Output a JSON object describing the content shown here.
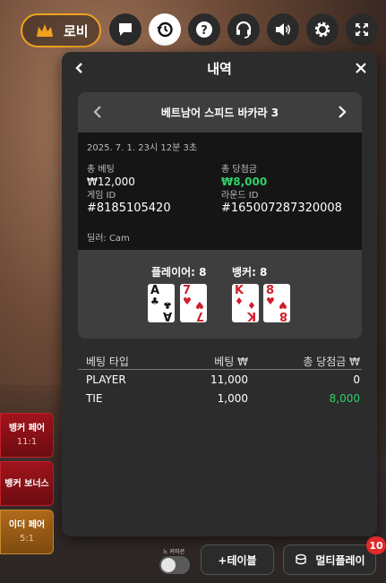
{
  "topbar": {
    "lobby_label": "로비",
    "icons": [
      "chat-icon",
      "history-icon",
      "help-icon",
      "headset-icon",
      "volume-icon",
      "gear-icon",
      "fullscreen-icon"
    ]
  },
  "side_bets": [
    {
      "title": "뱅커 페어",
      "sub": "11:1"
    },
    {
      "title": "뱅커 보너스",
      "sub": ""
    },
    {
      "title": "이더 페어",
      "sub": "5:1"
    }
  ],
  "modal": {
    "title": "내역",
    "game_name": "베트남어 스피드 바카라 3",
    "datetime": "2025. 7. 1. 23시 12분 3초",
    "total_bet_label": "총 베팅",
    "total_bet_value": "₩12,000",
    "total_win_label": "총 당첨금",
    "total_win_value": "₩8,000",
    "game_id_label": "게임 ID",
    "game_id_value": "#8185105420",
    "round_id_label": "라운드 ID",
    "round_id_value": "#165007287320008",
    "dealer": "딜러: Cam",
    "player_label": "플레이어: 8",
    "banker_label": "뱅커: 8",
    "player_cards": [
      {
        "rank": "A",
        "suit": "♣",
        "color": "black"
      },
      {
        "rank": "7",
        "suit": "♥",
        "color": "red"
      }
    ],
    "banker_cards": [
      {
        "rank": "K",
        "suit": "♦",
        "color": "red"
      },
      {
        "rank": "8",
        "suit": "♥",
        "color": "red"
      }
    ],
    "table_headers": [
      "베팅 타입",
      "베팅 ₩",
      "총 당첨금 ₩"
    ],
    "rows": [
      {
        "type": "PLAYER",
        "bet": "11,000",
        "win": "0",
        "win_color": "#ffffff"
      },
      {
        "type": "TIE",
        "bet": "1,000",
        "win": "8,000",
        "win_color": "#2fd06a"
      }
    ]
  },
  "bottom": {
    "toggle_label": "노 커미션",
    "add_table_label": "+테이블",
    "multiplay_label": "멀티플레이",
    "multiplay_badge": "10"
  },
  "colors": {
    "accent": "#f0a21e",
    "win_green": "#2fd06a",
    "badge_red": "#e12a2a"
  }
}
